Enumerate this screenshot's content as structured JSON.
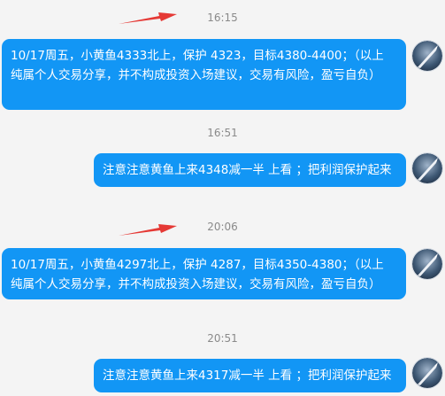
{
  "messages": [
    {
      "time": "16:15",
      "lines": [
        "10/17周五，小黄鱼4333北上，保护 4323，目标4380-4400；（以上",
        "纯属个人交易分享，并不构成投资入场建议，交易有风险，盈亏自负）"
      ]
    },
    {
      "time": "16:51",
      "lines": [
        "注意注意黄鱼上来4348减一半 上看 ；把利润保护起来"
      ]
    },
    {
      "time": "20:06",
      "lines": [
        "10/17周五，小黄鱼4297北上，保护 4287，目标4350-4380；（以上",
        "纯属个人交易分享，并不构成投资入场建议，交易有风险，盈亏自负）"
      ]
    },
    {
      "time": "20:51",
      "lines": [
        "注意注意黄鱼上来4317减一半 上看 ；把利润保护起来"
      ]
    }
  ],
  "colors": {
    "bubble": "#1296f5",
    "annotation_arrow": "#e53935",
    "background": "#f4f4f4",
    "timestamp_text": "#8a8a8a"
  },
  "icons": {
    "avatar": "rocket-sky-avatar-icon",
    "annotation": "red-arrow-icon"
  }
}
